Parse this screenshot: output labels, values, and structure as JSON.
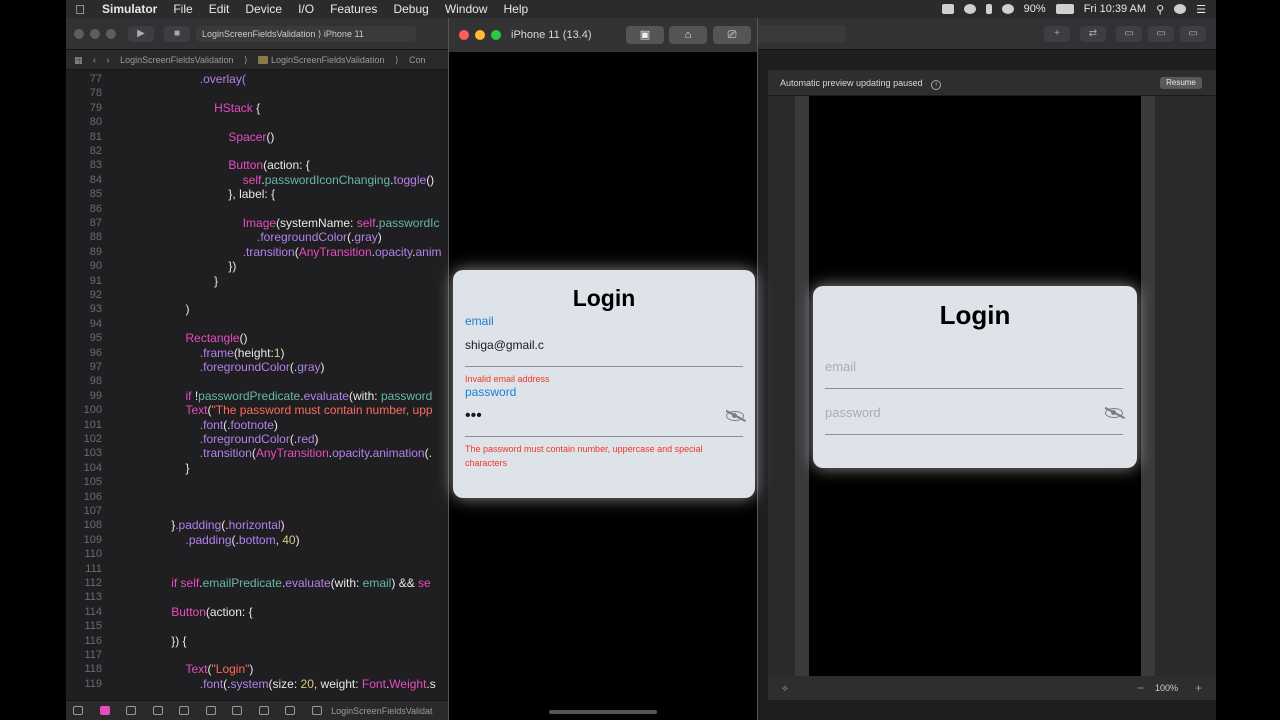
{
  "menubar": {
    "apple_icon": "apple-icon",
    "items": [
      "Simulator",
      "File",
      "Edit",
      "Device",
      "I/O",
      "Features",
      "Debug",
      "Window",
      "Help"
    ],
    "battery": "90%",
    "clock": "Fri 10:39 AM"
  },
  "xcode": {
    "scheme": "LoginScreenFieldsValidation",
    "device": "iPhone 11",
    "breadcrumb": [
      "LoginScreenFieldsValidation",
      "LoginScreenFieldsValidation",
      "Con"
    ]
  },
  "code_lines": [
    {
      "n": "77",
      "indent": 6,
      "parts": [
        [
          ".overlay(",
          "attr"
        ]
      ]
    },
    {
      "n": "78",
      "indent": 0,
      "parts": []
    },
    {
      "n": "79",
      "indent": 7,
      "parts": [
        [
          "HStack",
          "key"
        ],
        [
          " {",
          "plain"
        ]
      ]
    },
    {
      "n": "80",
      "indent": 0,
      "parts": []
    },
    {
      "n": "81",
      "indent": 8,
      "parts": [
        [
          "Spacer",
          "key"
        ],
        [
          "()",
          "plain"
        ]
      ]
    },
    {
      "n": "82",
      "indent": 0,
      "parts": []
    },
    {
      "n": "83",
      "indent": 8,
      "parts": [
        [
          "Button",
          "key"
        ],
        [
          "(action: {",
          "plain"
        ]
      ]
    },
    {
      "n": "84",
      "indent": 9,
      "parts": [
        [
          "self",
          "key"
        ],
        [
          ".",
          "plain"
        ],
        [
          "passwordIconChanging",
          "fn"
        ],
        [
          ".",
          "plain"
        ],
        [
          "toggle",
          "attr"
        ],
        [
          "()",
          "plain"
        ]
      ]
    },
    {
      "n": "85",
      "indent": 8,
      "parts": [
        [
          "}, label: {",
          "plain"
        ]
      ]
    },
    {
      "n": "86",
      "indent": 0,
      "parts": []
    },
    {
      "n": "87",
      "indent": 9,
      "parts": [
        [
          "Image",
          "key"
        ],
        [
          "(systemName: ",
          "plain"
        ],
        [
          "self",
          "key"
        ],
        [
          ".",
          "plain"
        ],
        [
          "passwordIc",
          "fn"
        ]
      ]
    },
    {
      "n": "88",
      "indent": 10,
      "parts": [
        [
          ".foregroundColor",
          "attr"
        ],
        [
          "(.",
          "plain"
        ],
        [
          "gray",
          "attr"
        ],
        [
          ")",
          "plain"
        ]
      ]
    },
    {
      "n": "89",
      "indent": 9,
      "parts": [
        [
          ".transition",
          "attr"
        ],
        [
          "(",
          "plain"
        ],
        [
          "AnyTransition",
          "key"
        ],
        [
          ".",
          "plain"
        ],
        [
          "opacity",
          "attr"
        ],
        [
          ".",
          "plain"
        ],
        [
          "anim",
          "attr"
        ]
      ]
    },
    {
      "n": "90",
      "indent": 8,
      "parts": [
        [
          "})",
          "plain"
        ]
      ]
    },
    {
      "n": "91",
      "indent": 7,
      "parts": [
        [
          "}",
          "plain"
        ]
      ]
    },
    {
      "n": "92",
      "indent": 0,
      "parts": []
    },
    {
      "n": "93",
      "indent": 5,
      "parts": [
        [
          ")",
          "plain"
        ]
      ]
    },
    {
      "n": "94",
      "indent": 0,
      "parts": []
    },
    {
      "n": "95",
      "indent": 5,
      "parts": [
        [
          "Rectangle",
          "key"
        ],
        [
          "()",
          "plain"
        ]
      ]
    },
    {
      "n": "96",
      "indent": 6,
      "parts": [
        [
          ".frame",
          "attr"
        ],
        [
          "(height:",
          "plain"
        ],
        [
          "1",
          "num"
        ],
        [
          ")",
          "plain"
        ]
      ]
    },
    {
      "n": "97",
      "indent": 6,
      "parts": [
        [
          ".foregroundColor",
          "attr"
        ],
        [
          "(.",
          "plain"
        ],
        [
          "gray",
          "attr"
        ],
        [
          ")",
          "plain"
        ]
      ]
    },
    {
      "n": "98",
      "indent": 0,
      "parts": []
    },
    {
      "n": "99",
      "indent": 5,
      "parts": [
        [
          "if",
          "key"
        ],
        [
          " !",
          "plain"
        ],
        [
          "passwordPredicate",
          "fn"
        ],
        [
          ".",
          "plain"
        ],
        [
          "evaluate",
          "attr"
        ],
        [
          "(with: ",
          "plain"
        ],
        [
          "password",
          "fn"
        ]
      ]
    },
    {
      "n": "100",
      "indent": 5,
      "parts": [
        [
          "Text",
          "key"
        ],
        [
          "(",
          "plain"
        ],
        [
          "\"The password must contain number, upp",
          "str"
        ]
      ]
    },
    {
      "n": "101",
      "indent": 6,
      "parts": [
        [
          ".font",
          "attr"
        ],
        [
          "(.",
          "plain"
        ],
        [
          "footnote",
          "attr"
        ],
        [
          ")",
          "plain"
        ]
      ]
    },
    {
      "n": "102",
      "indent": 6,
      "parts": [
        [
          ".foregroundColor",
          "attr"
        ],
        [
          "(.",
          "plain"
        ],
        [
          "red",
          "attr"
        ],
        [
          ")",
          "plain"
        ]
      ]
    },
    {
      "n": "103",
      "indent": 6,
      "parts": [
        [
          ".transition",
          "attr"
        ],
        [
          "(",
          "plain"
        ],
        [
          "AnyTransition",
          "key"
        ],
        [
          ".",
          "plain"
        ],
        [
          "opacity",
          "attr"
        ],
        [
          ".",
          "plain"
        ],
        [
          "animation",
          "attr"
        ],
        [
          "(.",
          "plain"
        ]
      ]
    },
    {
      "n": "104",
      "indent": 5,
      "parts": [
        [
          "}",
          "plain"
        ]
      ]
    },
    {
      "n": "105",
      "indent": 0,
      "parts": []
    },
    {
      "n": "106",
      "indent": 0,
      "parts": []
    },
    {
      "n": "107",
      "indent": 0,
      "parts": []
    },
    {
      "n": "108",
      "indent": 4,
      "parts": [
        [
          "}",
          "plain"
        ],
        [
          ".padding",
          "attr"
        ],
        [
          "(.",
          "plain"
        ],
        [
          "horizontal",
          "attr"
        ],
        [
          ")",
          "plain"
        ]
      ]
    },
    {
      "n": "109",
      "indent": 5,
      "parts": [
        [
          ".padding",
          "attr"
        ],
        [
          "(.",
          "plain"
        ],
        [
          "bottom",
          "attr"
        ],
        [
          ", ",
          "plain"
        ],
        [
          "40",
          "num"
        ],
        [
          ")",
          "plain"
        ]
      ]
    },
    {
      "n": "110",
      "indent": 0,
      "parts": []
    },
    {
      "n": "111",
      "indent": 0,
      "parts": []
    },
    {
      "n": "112",
      "indent": 4,
      "parts": [
        [
          "if",
          "key"
        ],
        [
          " ",
          "plain"
        ],
        [
          "self",
          "key"
        ],
        [
          ".",
          "plain"
        ],
        [
          "emailPredicate",
          "fn"
        ],
        [
          ".",
          "plain"
        ],
        [
          "evaluate",
          "attr"
        ],
        [
          "(with: ",
          "plain"
        ],
        [
          "email",
          "fn"
        ],
        [
          ") && ",
          "plain"
        ],
        [
          "se",
          "key"
        ]
      ]
    },
    {
      "n": "113",
      "indent": 0,
      "parts": []
    },
    {
      "n": "114",
      "indent": 4,
      "parts": [
        [
          "Button",
          "key"
        ],
        [
          "(action: {",
          "plain"
        ]
      ]
    },
    {
      "n": "115",
      "indent": 0,
      "parts": []
    },
    {
      "n": "116",
      "indent": 4,
      "parts": [
        [
          "}) {",
          "plain"
        ]
      ]
    },
    {
      "n": "117",
      "indent": 0,
      "parts": []
    },
    {
      "n": "118",
      "indent": 5,
      "parts": [
        [
          "Text",
          "key"
        ],
        [
          "(",
          "plain"
        ],
        [
          "\"Login\"",
          "str"
        ],
        [
          ")",
          "plain"
        ]
      ]
    },
    {
      "n": "119",
      "indent": 6,
      "parts": [
        [
          ".font",
          "attr"
        ],
        [
          "(.",
          "plain"
        ],
        [
          "system",
          "attr"
        ],
        [
          "(size: ",
          "plain"
        ],
        [
          "20",
          "num"
        ],
        [
          ", weight: ",
          "plain"
        ],
        [
          "Font",
          "key"
        ],
        [
          ".",
          "plain"
        ],
        [
          "Weight",
          "key"
        ],
        [
          ".s",
          "plain"
        ]
      ]
    }
  ],
  "editor_status": {
    "file": "LoginScreenFieldsValidat"
  },
  "simulator": {
    "title": "iPhone 11 (13.4)",
    "buttons": [
      "screenshot-icon",
      "home-icon",
      "rotate-icon"
    ],
    "card": {
      "title": "Login",
      "email_label": "email",
      "email_value": "shiga@gmail.c",
      "email_error": "Invalid email address",
      "password_label": "password",
      "password_value": "•••",
      "password_error": "The password must contain number, uppercase and special characters",
      "eye_icon": "eye-slash-icon"
    }
  },
  "preview": {
    "status": "Automatic preview updating paused",
    "resume_label": "Resume",
    "zoom": "100%",
    "card": {
      "title": "Login",
      "email_placeholder": "email",
      "password_placeholder": "password",
      "eye_icon": "eye-slash-icon"
    }
  },
  "colors": {
    "keyword": "#e64cc0",
    "string": "#fc6a5d",
    "label_blue": "#1a7fd0",
    "error_red": "#f0362a",
    "card_bg": "#dee3ea"
  }
}
